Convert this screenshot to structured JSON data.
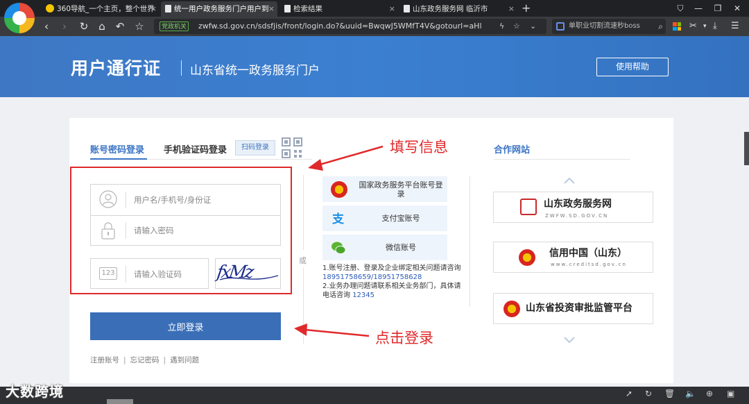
{
  "browser": {
    "tabs": [
      {
        "label": "360导航_一个主页，整个世界",
        "close": "×"
      },
      {
        "label": "统一用户政务服务门户用户到",
        "close": "×"
      },
      {
        "label": "检索结果",
        "close": "×"
      },
      {
        "label": "山东政务服务网 临沂市",
        "close": "×"
      }
    ],
    "new_tab": "+",
    "gov_tag": "党政机关",
    "url": "zwfw.sd.gov.cn/sdsfjis/front/login.do?&uuid=BwqwJ5WMfT4V&gotourl=aHl",
    "search_text": "单职业切割流速秒boss"
  },
  "header": {
    "brand": "用户通行证",
    "subtitle": "山东省统一政务服务门户",
    "help_label": "使用帮助"
  },
  "login": {
    "tab_account": "账号密码登录",
    "tab_sms": "手机验证码登录",
    "tab_qr": "扫码登录",
    "username_placeholder": "用户名/手机号/身份证",
    "password_placeholder": "请输入密码",
    "captcha_placeholder": "请输入验证码",
    "captcha_icon_text": "123",
    "captcha_text": "fxMz",
    "submit_label": "立即登录",
    "or_text": "或",
    "links": {
      "register": "注册账号",
      "forgot": "忘记密码",
      "problem": "遇到问题",
      "sep": "|"
    }
  },
  "alt_login": {
    "national": "国家政务服务平台账号登录",
    "alipay": "支付宝账号",
    "wechat": "微信账号",
    "note1": "1.账号注册、登录及企业绑定相关问题请咨询",
    "note1_phone": "18951758659/18951758628",
    "note2": "2.业务办理问题请联系相关业务部门，具体请电话咨询",
    "note2_phone": "12345"
  },
  "partners": {
    "title": "合作网站",
    "items": [
      {
        "name": "山东政务服务网",
        "url": "ZWFW.SD.GOV.CN"
      },
      {
        "name": "信用中国（山东）",
        "url": "www.creditsd.gov.cn"
      },
      {
        "name": "山东省投资审批监管平台",
        "url": ""
      }
    ]
  },
  "annotations": {
    "fill_info": "填写信息",
    "click_login": "点击登录"
  },
  "watermark": "大数跨境",
  "colors": {
    "brand_blue": "#3b74c4",
    "header_blue": "#3b7fd1",
    "button_blue": "#3a6fb8",
    "annotation_red": "#e0292b"
  }
}
